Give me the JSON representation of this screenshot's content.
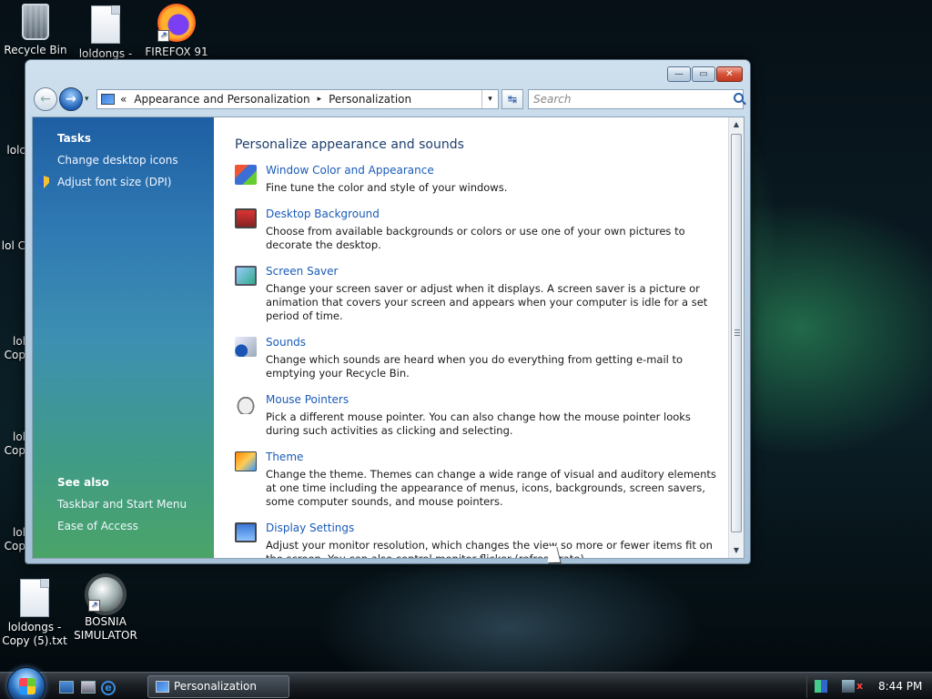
{
  "desktop": {
    "icons": [
      {
        "label": "Recycle Bin"
      },
      {
        "label": "loldongs -"
      },
      {
        "label": "FIREFOX 91"
      },
      {
        "label": "loldongs - Copy (5).txt"
      },
      {
        "label": "BOSNIA SIMULATOR"
      }
    ],
    "partial_labels": [
      "lolc",
      "lol C",
      "lol Cop",
      "lol Cop",
      "lol Cop"
    ]
  },
  "window": {
    "caption": {
      "minimize": "—",
      "maximize": "▭",
      "close": "✕"
    },
    "nav": {
      "back": "←",
      "forward": "→",
      "recent": "▾"
    },
    "address": {
      "prefix": "«",
      "crumbs": [
        "Appearance and Personalization",
        "Personalization"
      ],
      "separator": "▸",
      "dropdown": "▾",
      "refresh": "↹"
    },
    "search": {
      "placeholder": "Search"
    },
    "sidebar": {
      "tasks_heading": "Tasks",
      "tasks": [
        "Change desktop icons",
        "Adjust font size (DPI)"
      ],
      "see_also_heading": "See also",
      "see_also": [
        "Taskbar and Start Menu",
        "Ease of Access"
      ]
    },
    "main": {
      "title": "Personalize appearance and sounds",
      "items": [
        {
          "title": "Window Color and Appearance",
          "desc": "Fine tune the color and style of your windows."
        },
        {
          "title": "Desktop Background",
          "desc": "Choose from available backgrounds or colors or use one of your own pictures to decorate the desktop."
        },
        {
          "title": "Screen Saver",
          "desc": "Change your screen saver or adjust when it displays. A screen saver is a picture or animation that covers your screen and appears when your computer is idle for a set period of time."
        },
        {
          "title": "Sounds",
          "desc": "Change which sounds are heard when you do everything from getting e-mail to emptying your Recycle Bin."
        },
        {
          "title": "Mouse Pointers",
          "desc": "Pick a different mouse pointer. You can also change how the mouse pointer looks during such activities as clicking and selecting."
        },
        {
          "title": "Theme",
          "desc": "Change the theme. Themes can change a wide range of visual and auditory elements at one time including the appearance of menus, icons, backgrounds, screen savers, some computer sounds, and mouse pointers."
        },
        {
          "title": "Display Settings",
          "desc": "Adjust your monitor resolution, which changes the view so more or fewer items fit on the screen. You can also control monitor flicker (refresh rate)."
        }
      ]
    },
    "scrollbar": {
      "up": "▲",
      "down": "▼"
    }
  },
  "taskbar": {
    "active_window": "Personalization",
    "quick_launch_ie": "e",
    "tray_mute": "x",
    "clock": "8:44 PM"
  }
}
